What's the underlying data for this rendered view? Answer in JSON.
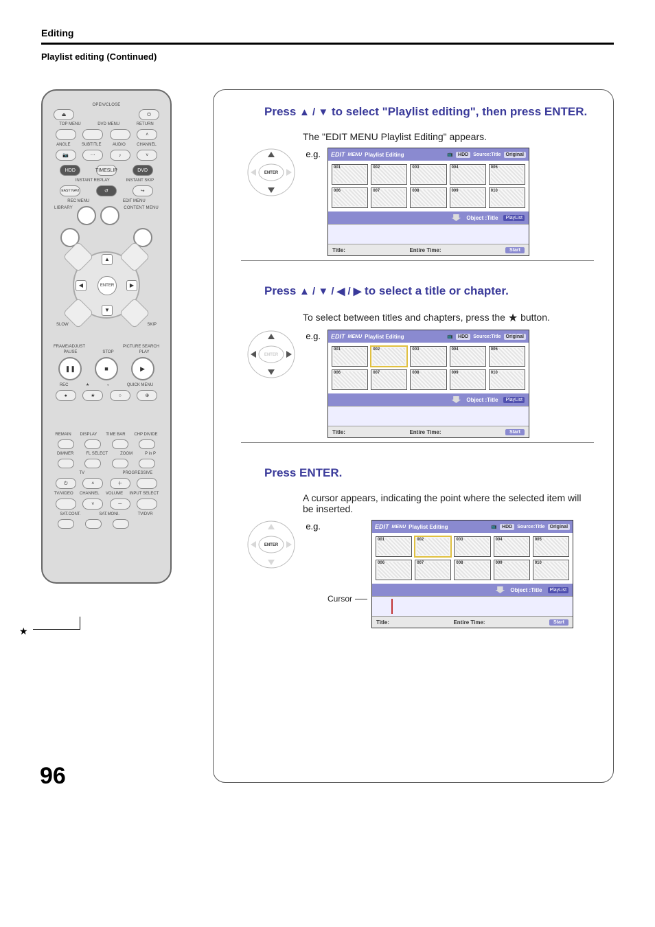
{
  "header": {
    "section": "Editing",
    "subsection": "Playlist editing (Continued)"
  },
  "page_number": "96",
  "remote": {
    "labels": {
      "open_close": "OPEN/CLOSE",
      "power": "⏻",
      "top_menu": "TOP MENU",
      "dvd_menu": "DVD MENU",
      "return": "RETURN",
      "angle": "ANGLE",
      "subtitle": "SUBTITLE",
      "audio": "AUDIO",
      "channel": "CHANNEL",
      "hdd": "HDD",
      "timeslip": "TIMESLIP",
      "dvd": "DVD",
      "instant_replay": "INSTANT REPLAY",
      "instant_skip": "INSTANT SKIP",
      "easy_navi": "EASY NAVI",
      "rec_menu": "REC MENU",
      "edit_menu": "EDIT MENU",
      "library": "LIBRARY",
      "content_menu": "CONTENT MENU",
      "slow_l": "SLOW",
      "slow_r": "SKIP",
      "frame_adj": "FRAME/ADJUST",
      "pic_search": "PICTURE SEARCH",
      "enter": "ENTER",
      "pause": "PAUSE",
      "stop": "STOP",
      "play": "PLAY",
      "rec": "REC",
      "star": "★",
      "circle": "○",
      "quick_menu": "QUICK MENU",
      "remain": "REMAIN",
      "display": "DISPLAY",
      "time_bar": "TIME BAR",
      "chp_divide": "CHP DIVIDE",
      "dimmer": "DIMMER",
      "fl_select": "FL SELECT",
      "zoom": "ZOOM",
      "pinp": "P in P",
      "tv": "TV",
      "progressive": "PROGRESSIVE",
      "tv_video": "TV/VIDEO",
      "channel2": "CHANNEL",
      "volume": "VOLUME",
      "input_select": "INPUT SELECT",
      "sat_cont": "SAT.CONT.",
      "sat_moni": "SAT.MONI.",
      "tv_dvr": "TV/DVR"
    }
  },
  "steps": [
    {
      "title_prefix": "Press ",
      "arrows": "▲ / ▼",
      "title_mid": " to select \"Playlist editing\", then press ENTER.",
      "body": "The \"EDIT MENU Playlist Editing\" appears.",
      "eg": "e.g.",
      "navpad": {
        "up": true,
        "down": true,
        "left": false,
        "right": false,
        "enter_active": true
      },
      "osd": {
        "menu": "EDIT",
        "menu2": "MENU",
        "heading": "Playlist Editing",
        "hdd": "HDD",
        "source_title": "Source:Title",
        "original": "Original",
        "thumbs": [
          "001",
          "002",
          "003",
          "004",
          "005",
          "006",
          "007",
          "008",
          "009",
          "010"
        ],
        "selected_thumb": -1,
        "object_label": "Object :Title",
        "playlist": "PlayList",
        "title_lbl": "Title:",
        "entire_time_lbl": "Entire Time:",
        "start": "Start",
        "show_cursor": false
      }
    },
    {
      "title_prefix": "Press ",
      "arrows": "▲ / ▼ / ◀ / ▶",
      "title_mid": " to select a title or chapter.",
      "body_prefix": "To select between titles and chapters, press the ",
      "body_star": "★",
      "body_suffix": " button.",
      "eg": "e.g.",
      "navpad": {
        "up": true,
        "down": true,
        "left": true,
        "right": true,
        "enter_active": false
      },
      "osd": {
        "menu": "EDIT",
        "menu2": "MENU",
        "heading": "Playlist Editing",
        "hdd": "HDD",
        "source_title": "Source:Title",
        "original": "Original",
        "thumbs": [
          "001",
          "002",
          "003",
          "004",
          "005",
          "006",
          "007",
          "008",
          "009",
          "010"
        ],
        "selected_thumb": 1,
        "object_label": "Object :Title",
        "playlist": "PlayList",
        "title_lbl": "Title:",
        "entire_time_lbl": "Entire Time:",
        "start": "Start",
        "show_cursor": false
      }
    },
    {
      "title_prefix": "Press ENTER.",
      "arrows": "",
      "title_mid": "",
      "body": "A cursor appears, indicating the point where the selected item will be inserted.",
      "eg": "e.g.",
      "cursor_label": "Cursor",
      "navpad": {
        "up": false,
        "down": false,
        "left": false,
        "right": false,
        "enter_active": true
      },
      "osd": {
        "menu": "EDIT",
        "menu2": "MENU",
        "heading": "Playlist Editing",
        "hdd": "HDD",
        "source_title": "Source:Title",
        "original": "Original",
        "thumbs": [
          "001",
          "002",
          "003",
          "004",
          "005",
          "006",
          "007",
          "008",
          "009",
          "010"
        ],
        "selected_thumb": 1,
        "object_label": "Object :Title",
        "playlist": "PlayList",
        "title_lbl": "Title:",
        "entire_time_lbl": "Entire Time:",
        "start": "Start",
        "show_cursor": true
      }
    }
  ]
}
